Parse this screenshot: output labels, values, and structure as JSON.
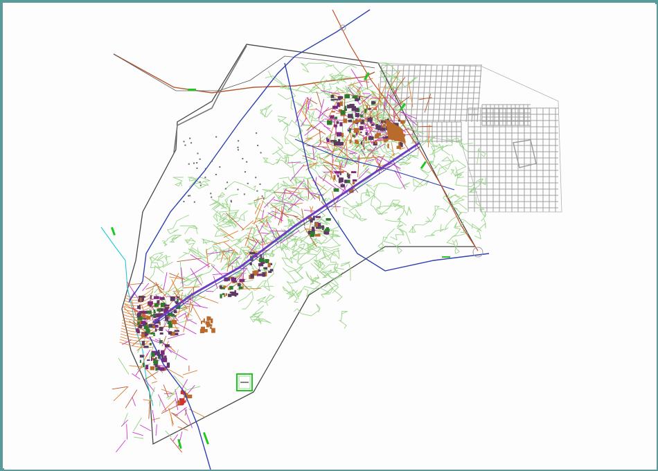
{
  "map": {
    "title": "",
    "colors": {
      "background": "#fdfdfd",
      "frame": "#5b9a9a",
      "boundary": "#444444",
      "grey_grid": "#9e9e9e",
      "green_roads": "#8fd17d",
      "magenta_roads": "#cc33cc",
      "orange_roads": "#e07a2a",
      "brown_road": "#b5562a",
      "blue_highway": "#2d3fb0",
      "purple_axis": "#6a3fc0",
      "dark_blocks": "#5a3b5f",
      "brown_blocks": "#b86b2c",
      "cyan_river": "#22c8d8",
      "green_label": "#21c621"
    }
  }
}
